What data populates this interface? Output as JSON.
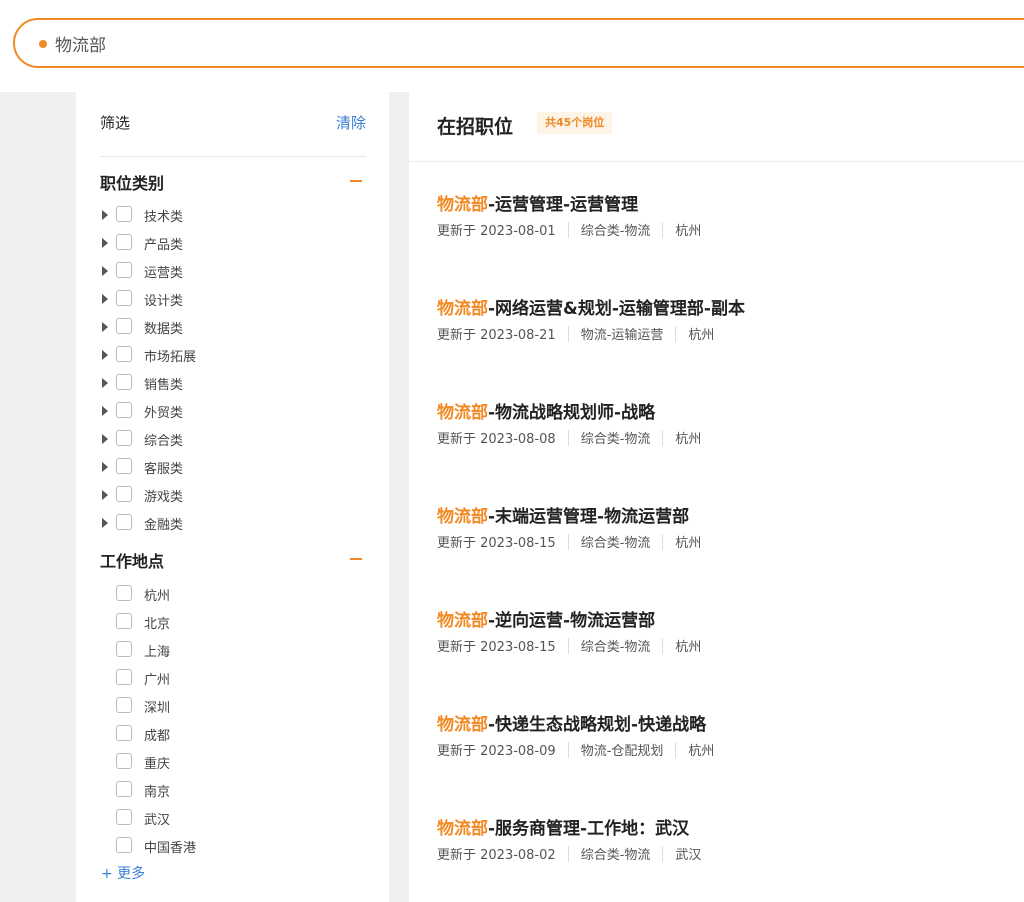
{
  "search": {
    "value": "物流部"
  },
  "filter": {
    "title": "筛选",
    "clear_label": "清除",
    "categories": {
      "title": "职位类别",
      "items": [
        "技术类",
        "产品类",
        "运营类",
        "设计类",
        "数据类",
        "市场拓展",
        "销售类",
        "外贸类",
        "综合类",
        "客服类",
        "游戏类",
        "金融类"
      ]
    },
    "locations": {
      "title": "工作地点",
      "items": [
        "杭州",
        "北京",
        "上海",
        "广州",
        "深圳",
        "成都",
        "重庆",
        "南京",
        "武汉",
        "中国香港"
      ]
    },
    "more_label": "+ 更多"
  },
  "main": {
    "title": "在招职位",
    "count_badge": "共45个岗位",
    "jobs": [
      {
        "dept": "物流部",
        "title": "-运营管理-运营管理",
        "updated": "更新于 2023-08-01",
        "category": "综合类-物流",
        "city": "杭州"
      },
      {
        "dept": "物流部",
        "title": "-网络运营&规划-运输管理部-副本",
        "updated": "更新于 2023-08-21",
        "category": "物流-运输运营",
        "city": "杭州"
      },
      {
        "dept": "物流部",
        "title": "-物流战略规划师-战略",
        "updated": "更新于 2023-08-08",
        "category": "综合类-物流",
        "city": "杭州"
      },
      {
        "dept": "物流部",
        "title": "-末端运营管理-物流运营部",
        "updated": "更新于 2023-08-15",
        "category": "综合类-物流",
        "city": "杭州"
      },
      {
        "dept": "物流部",
        "title": "-逆向运营-物流运营部",
        "updated": "更新于 2023-08-15",
        "category": "综合类-物流",
        "city": "杭州"
      },
      {
        "dept": "物流部",
        "title": "-快递生态战略规划-快递战略",
        "updated": "更新于 2023-08-09",
        "category": "物流-仓配规划",
        "city": "杭州"
      },
      {
        "dept": "物流部",
        "title": "-服务商管理-工作地：武汉",
        "updated": "更新于 2023-08-02",
        "category": "综合类-物流",
        "city": "武汉"
      }
    ]
  },
  "colors": {
    "accent": "#f08a24",
    "link": "#3a7fd5"
  }
}
